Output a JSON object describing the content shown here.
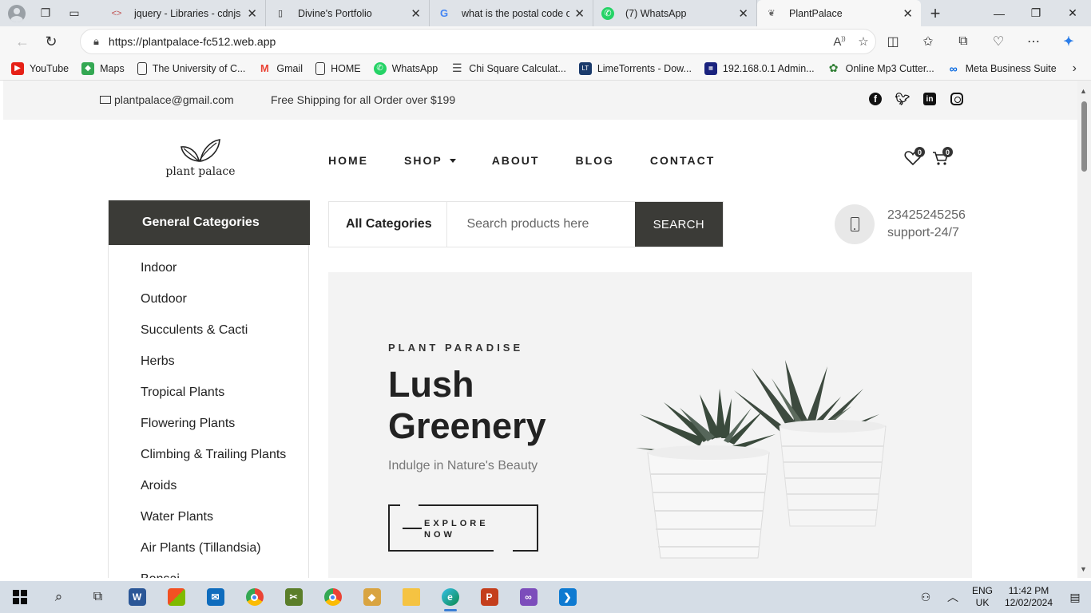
{
  "browser": {
    "tabs": [
      {
        "title": "jquery - Libraries - cdnjs - T",
        "favicon": "code-icon",
        "active": false
      },
      {
        "title": "Divine's Portfolio",
        "favicon": "page-icon",
        "active": false
      },
      {
        "title": "what is the postal code of Iba",
        "favicon": "google-icon",
        "active": false
      },
      {
        "title": "(7) WhatsApp",
        "favicon": "whatsapp-icon",
        "active": false
      },
      {
        "title": "PlantPalace",
        "favicon": "plant-icon",
        "active": true
      }
    ],
    "url": "https://plantpalace-fc512.web.app",
    "bookmarks": [
      {
        "label": "YouTube",
        "icon": "youtube-icon",
        "color": "#e62117"
      },
      {
        "label": "Maps",
        "icon": "maps-icon",
        "color": "#34a853"
      },
      {
        "label": "The University of C...",
        "icon": "page-icon",
        "color": ""
      },
      {
        "label": "Gmail",
        "icon": "gmail-icon",
        "color": "#ea4335"
      },
      {
        "label": "HOME",
        "icon": "page-icon",
        "color": ""
      },
      {
        "label": "WhatsApp",
        "icon": "whatsapp-icon",
        "color": "#25d366"
      },
      {
        "label": "Chi Square Calculat...",
        "icon": "calculator-icon",
        "color": "#555555"
      },
      {
        "label": "LimeTorrents - Dow...",
        "icon": "limetorrents-icon",
        "color": "#1a3a6b"
      },
      {
        "label": "192.168.0.1 Admin...",
        "icon": "router-icon",
        "color": "#1a237e"
      },
      {
        "label": "Online Mp3 Cutter...",
        "icon": "scissors-icon",
        "color": "#2e7d32"
      },
      {
        "label": "Meta Business Suite",
        "icon": "meta-icon",
        "color": "#0668e1"
      }
    ]
  },
  "site": {
    "email": "plantpalace@gmail.com",
    "shipping": "Free Shipping for all Order over $199",
    "logo_text": "plant palace",
    "nav": [
      "HOME",
      "SHOP",
      "ABOUT",
      "BLOG",
      "CONTACT"
    ],
    "wishlist_count": "0",
    "cart_count": "0",
    "categories_title": "General Categories",
    "categories": [
      "Indoor",
      "Outdoor",
      "Succulents & Cacti",
      "Herbs",
      "Tropical Plants",
      "Flowering Plants",
      "Climbing & Trailing Plants",
      "Aroids",
      "Water Plants",
      "Air Plants (Tillandsia)",
      "Bonsai"
    ],
    "search": {
      "category": "All Categories",
      "placeholder": "Search products here",
      "button": "SEARCH"
    },
    "phone": "23425245256",
    "support": "support-24/7",
    "hero": {
      "kicker": "PLANT PARADISE",
      "title_line1": "Lush",
      "title_line2": "Greenery",
      "subtitle": "Indulge in Nature's Beauty",
      "cta_line1": "EXPLORE",
      "cta_line2": "NOW"
    }
  },
  "taskbar": {
    "lang1": "ENG",
    "lang2": "UK",
    "time": "11:42 PM",
    "date": "12/02/2024"
  }
}
